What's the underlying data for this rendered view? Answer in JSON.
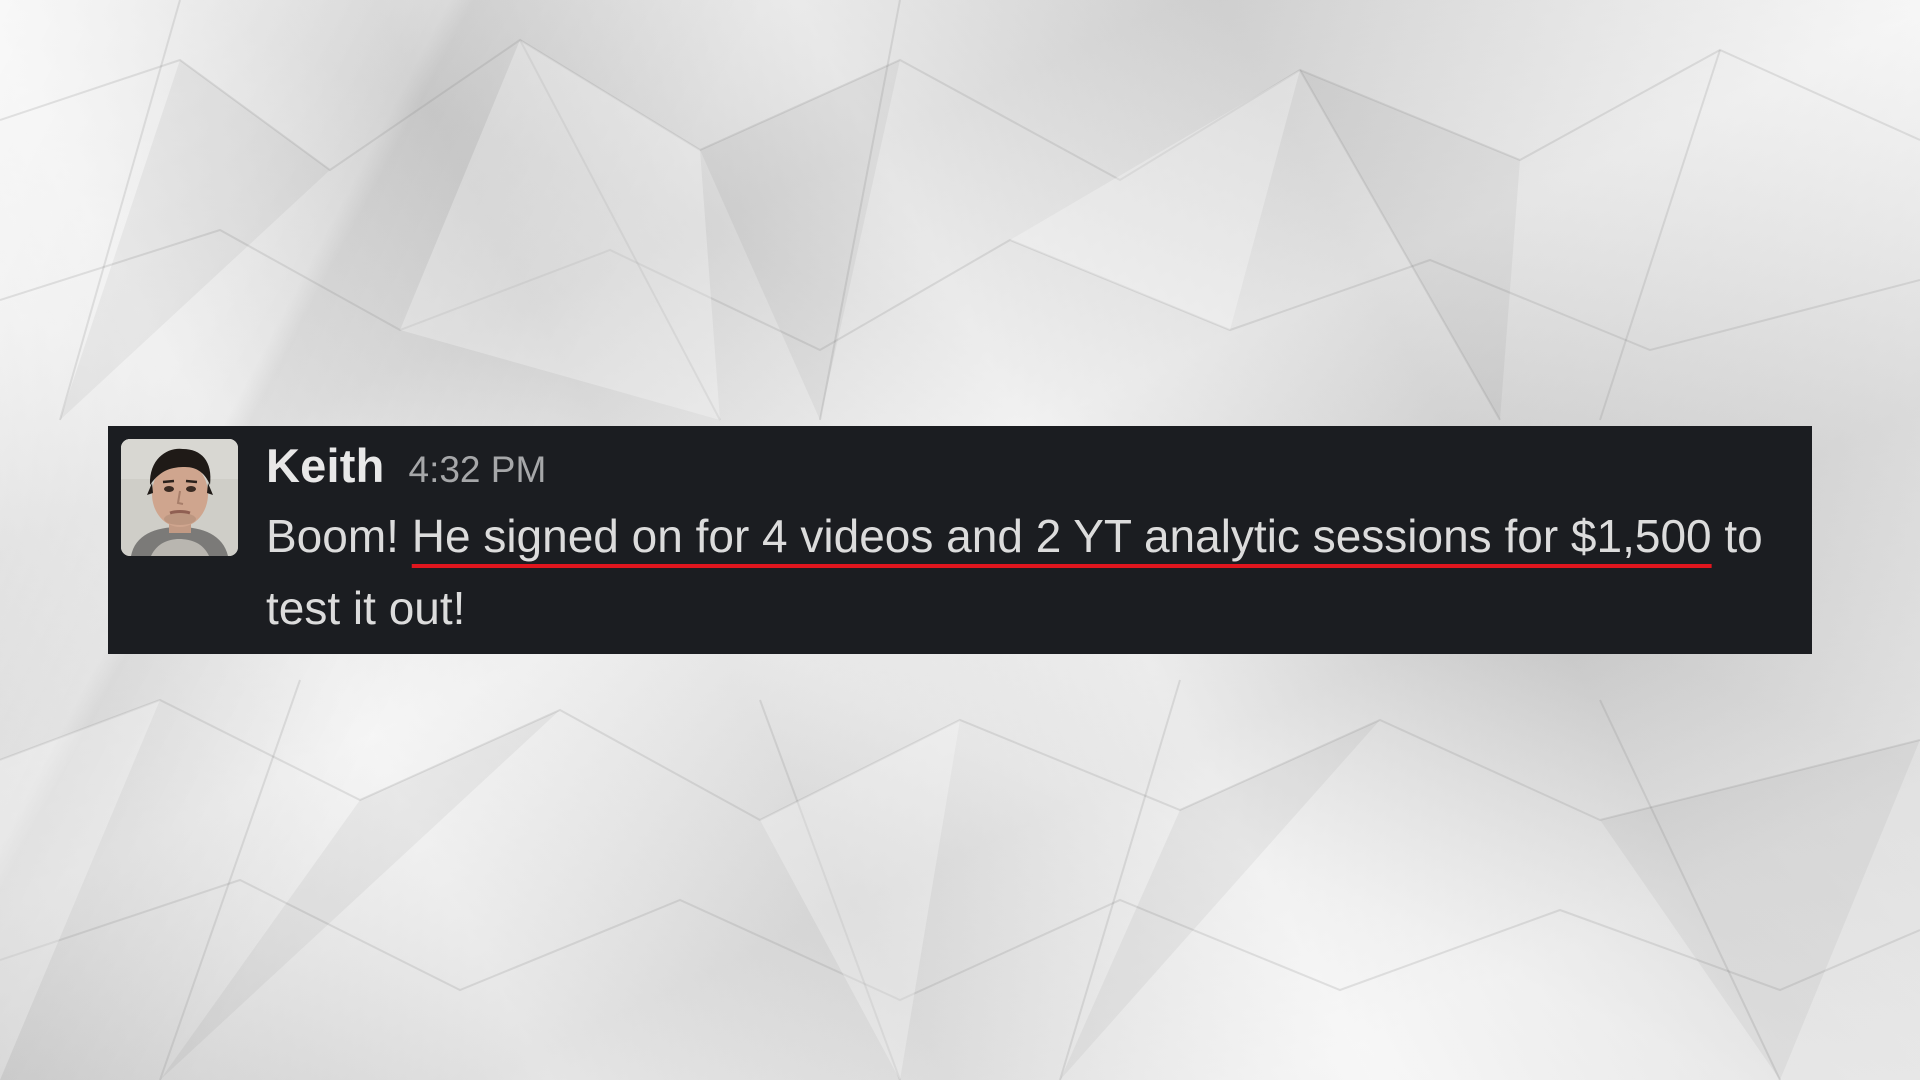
{
  "message": {
    "sender": "Keith",
    "time": "4:32 PM",
    "text_before": "Boom! ",
    "text_highlight": "He signed on for 4 videos and 2 YT analytic sessions for $1,500",
    "text_after": " to test it out!"
  },
  "colors": {
    "card_background": "#1b1d21",
    "underline": "#e0161e",
    "page_background": "#e6e6e6"
  },
  "icons": {
    "avatar": "user-avatar-photo"
  }
}
